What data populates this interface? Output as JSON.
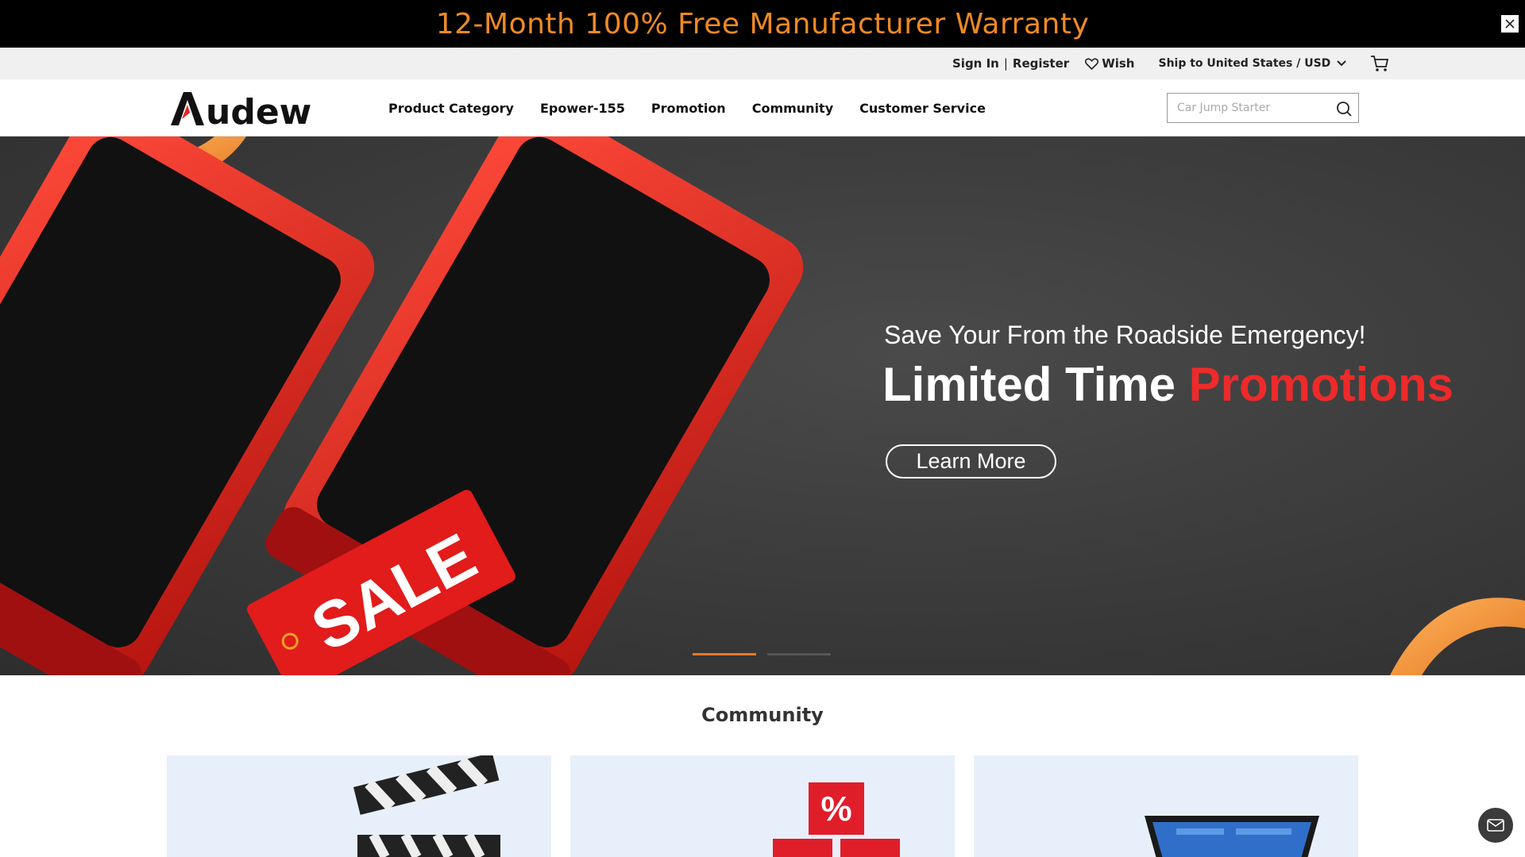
{
  "announcement": {
    "text": "12-Month 100% Free Manufacturer Warranty",
    "close_icon": "close-icon"
  },
  "utility": {
    "sign_in": "Sign In",
    "separator": "|",
    "register": "Register",
    "wish": "Wish",
    "ship": "Ship to United States / USD"
  },
  "header": {
    "logo": "Audew",
    "nav": [
      "Product Category",
      "Epower-155",
      "Promotion",
      "Community",
      "Customer Service"
    ],
    "search": {
      "placeholder": "Car Jump Starter"
    }
  },
  "hero": {
    "subtitle": "Save Your From the Roadside Emergency!",
    "title_main": "Limited Time ",
    "title_accent": "Promotions",
    "button": "Learn More",
    "sale_tag": "SALE",
    "slides": 2,
    "active_slide": 1
  },
  "community": {
    "title": "Community",
    "cards": [
      "video-clapperboard",
      "discount-boxes",
      "laptop"
    ]
  },
  "colors": {
    "banner_text": "#f08a24",
    "accent_red": "#ee2a2a",
    "slider_active": "#e87a22",
    "card_bg": "#e7f0fa"
  }
}
